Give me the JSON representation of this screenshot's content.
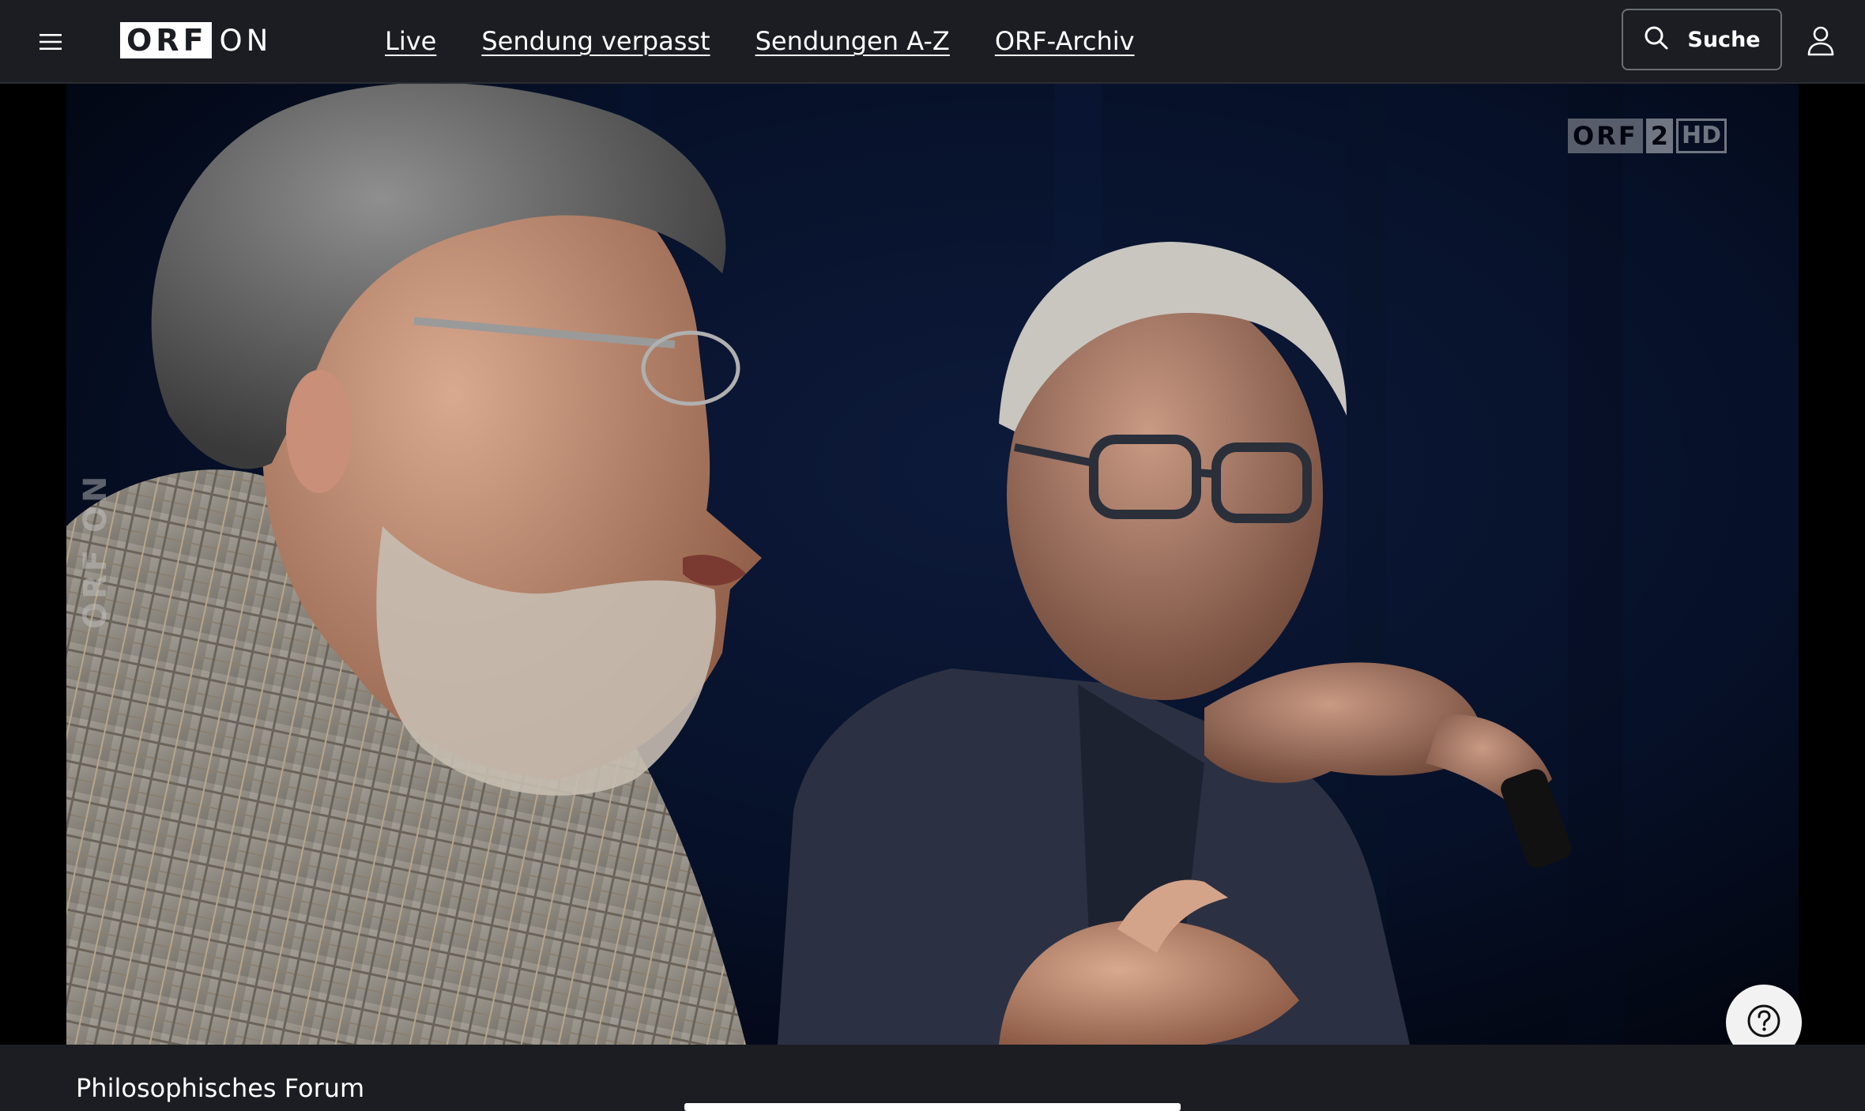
{
  "header": {
    "menu_icon": "hamburger-menu-icon",
    "logo": {
      "box_text": "ORF",
      "suffix": "ON"
    },
    "nav": [
      {
        "label": "Live"
      },
      {
        "label": "Sendung verpasst"
      },
      {
        "label": "Sendungen A-Z"
      },
      {
        "label": "ORF-Archiv"
      }
    ],
    "search": {
      "label": "Suche",
      "icon": "search-icon"
    },
    "user_icon": "user-profile-icon"
  },
  "player": {
    "side_watermark": "ORF ON",
    "channel_bug": {
      "brand": "ORF",
      "number": "2",
      "quality": "HD"
    },
    "help_icon": "help-question-icon"
  },
  "content": {
    "title": "Philosophisches Forum"
  },
  "colors": {
    "background": "#1b1d22",
    "text": "#ffffff",
    "player_background": "#000000"
  }
}
